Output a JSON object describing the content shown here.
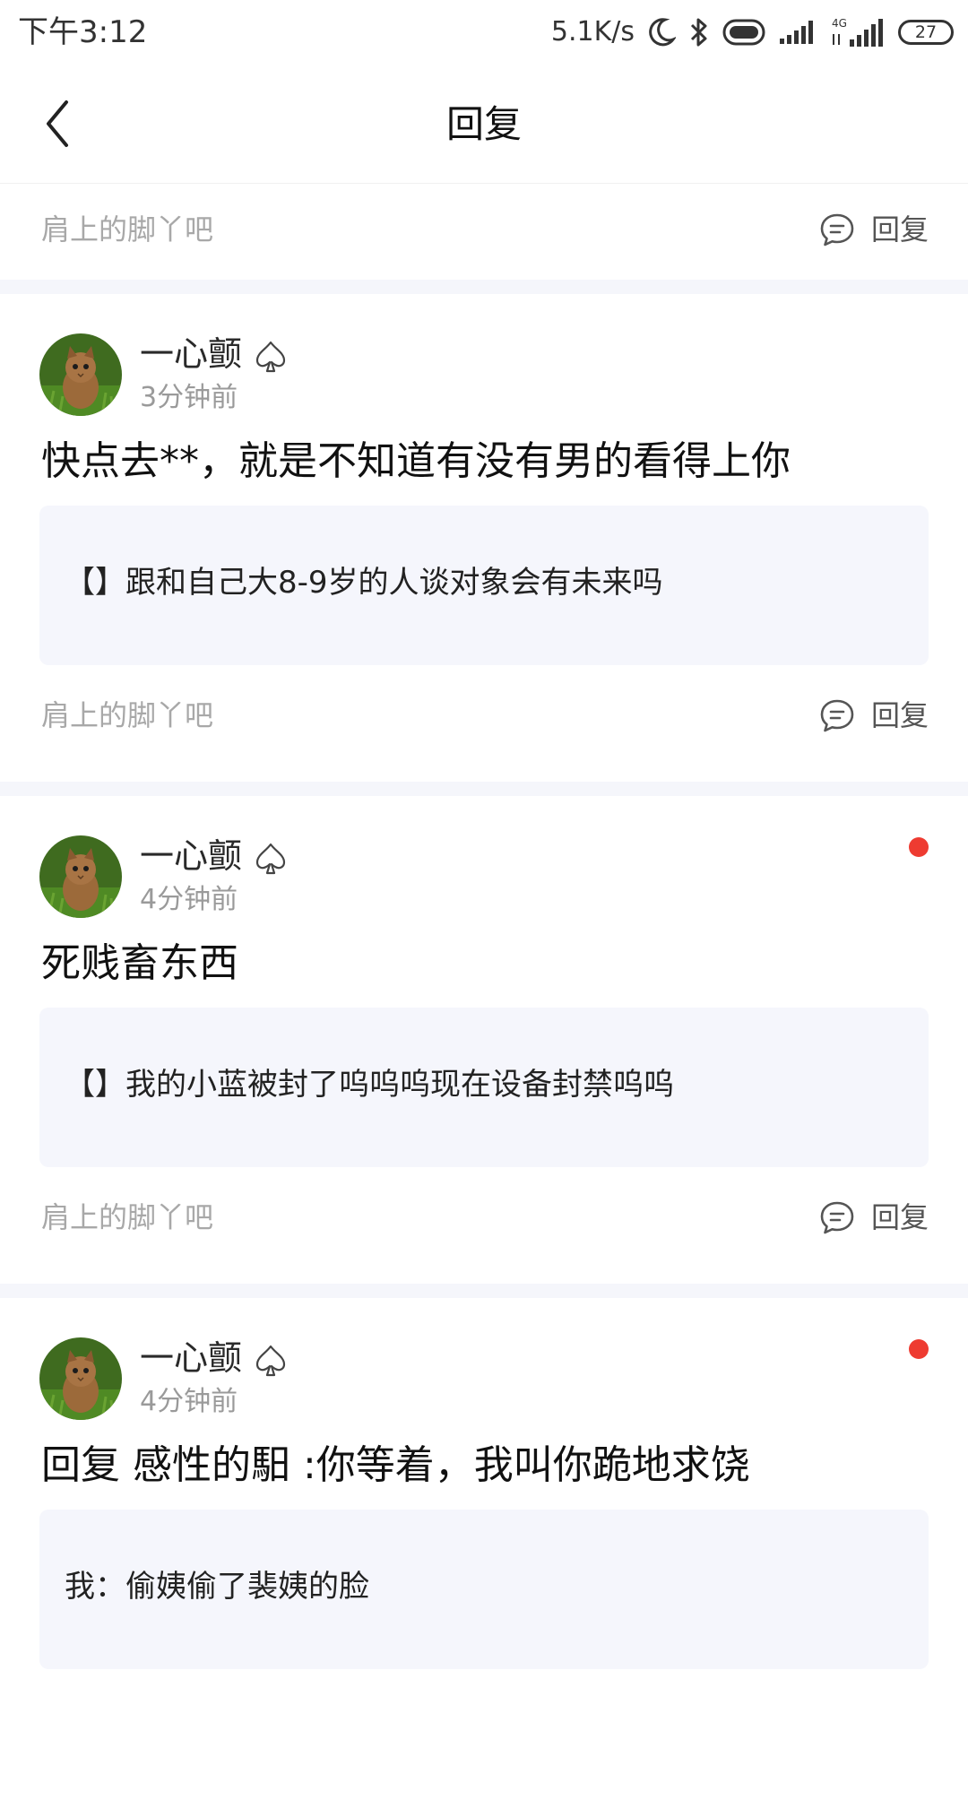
{
  "status_bar": {
    "time": "下午3:12",
    "net_speed": "5.1K/s",
    "network_type": "4G",
    "battery_level": "27",
    "icons": [
      "moon-icon",
      "bluetooth-icon",
      "toggle-icon",
      "signal-icon",
      "signal-4g-icon",
      "battery-icon"
    ]
  },
  "header": {
    "title": "回复",
    "back_icon": "chevron-left-icon"
  },
  "top_footer": {
    "source": "肩上的脚丫吧",
    "reply_label": "回复"
  },
  "cards": [
    {
      "author": "一心颤",
      "time": "3分钟前",
      "unread": false,
      "comment": "快点去**，就是不知道有没有男的看得上你",
      "quote": "【】跟和自己大8-9岁的人谈对象会有未来吗",
      "source": "肩上的脚丫吧",
      "reply_label": "回复"
    },
    {
      "author": "一心颤",
      "time": "4分钟前",
      "unread": true,
      "comment": "死贱畜东西",
      "quote": "【】我的小蓝被封了呜呜呜现在设备封禁呜呜",
      "source": "肩上的脚丫吧",
      "reply_label": "回复"
    },
    {
      "author": "一心颤",
      "time": "4分钟前",
      "unread": true,
      "comment": "回复 感性的馹 :你等着，我叫你跪地求饶",
      "quote": "我：偷姨偷了裴姨的脸"
    }
  ],
  "colors": {
    "accent_dot": "#ee3b31",
    "quote_bg": "#f5f6fc",
    "separator": "#f5f6fb",
    "muted_text": "#a8a8a8"
  }
}
